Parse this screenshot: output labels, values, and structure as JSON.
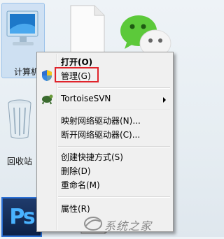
{
  "desktop": {
    "icons": {
      "computer": "计算机",
      "recycle_bin": "回收站",
      "photoshop": "Ps"
    }
  },
  "context_menu": {
    "items": {
      "open": "打开(O)",
      "manage": "管理(G)",
      "tortoise": "TortoiseSVN",
      "map_drive": "映射网络驱动器(N)...",
      "disconnect_drive": "断开网络驱动器(C)...",
      "create_shortcut": "创建快捷方式(S)",
      "delete": "删除(D)",
      "rename": "重命名(M)",
      "properties": "属性(R)"
    }
  },
  "watermark": {
    "text": "系统之家"
  },
  "colors": {
    "highlight_box": "#e0232b",
    "menu_bg": "#f0f0f0",
    "ps_text": "#49b2ff"
  }
}
